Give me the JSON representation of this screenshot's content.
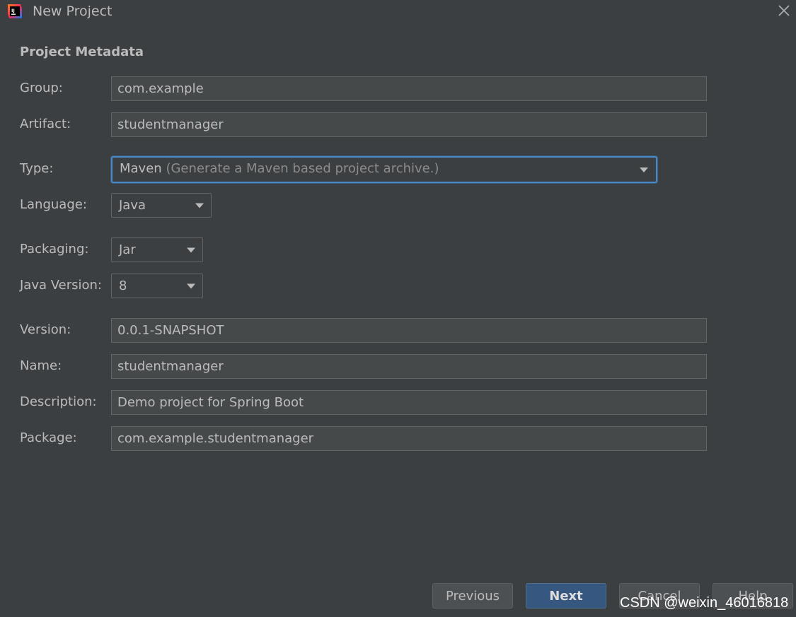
{
  "window": {
    "title": "New Project",
    "icon": "intellij-idea-icon",
    "close_icon": "close-icon"
  },
  "section": {
    "title": "Project Metadata"
  },
  "form": {
    "group": {
      "label": "Group:",
      "value": "com.example"
    },
    "artifact": {
      "label": "Artifact:",
      "value": "studentmanager"
    },
    "type": {
      "label": "Type:",
      "value": "Maven",
      "description": "(Generate a Maven based project archive.)"
    },
    "language": {
      "label": "Language:",
      "value": "Java"
    },
    "packaging": {
      "label": "Packaging:",
      "value": "Jar"
    },
    "java_version": {
      "label": "Java Version:",
      "value": "8"
    },
    "version": {
      "label": "Version:",
      "value": "0.0.1-SNAPSHOT"
    },
    "name": {
      "label": "Name:",
      "value": "studentmanager"
    },
    "description": {
      "label": "Description:",
      "value": "Demo project for Spring Boot"
    },
    "package": {
      "label": "Package:",
      "value": "com.example.studentmanager"
    }
  },
  "buttons": {
    "previous": "Previous",
    "next": "Next",
    "cancel": "Cancel",
    "help": "Help"
  },
  "watermark": "CSDN @weixin_46016818",
  "colors": {
    "background": "#3c3f41",
    "input_background": "#45494a",
    "focus_border": "#4a88c7",
    "primary_button": "#365880",
    "text": "#bbbbbb",
    "hint_text": "#8c8c8c"
  }
}
